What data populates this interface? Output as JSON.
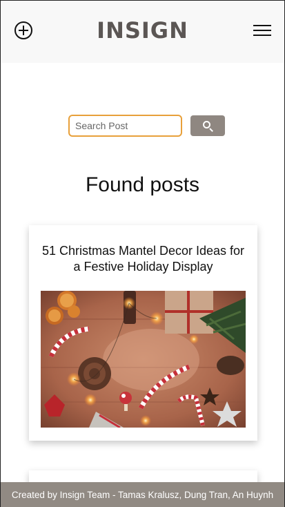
{
  "header": {
    "logo": "INSIGN",
    "add_icon": "plus-circle-icon",
    "menu_icon": "hamburger-menu-icon"
  },
  "search": {
    "placeholder": "Search Post",
    "value": "",
    "button_icon": "search-icon"
  },
  "main": {
    "heading": "Found posts",
    "posts": [
      {
        "title": "51 Christmas Mantel Decor Ideas for a Festive Holiday Display",
        "image": "christmas-decor-photo"
      }
    ]
  },
  "footer": {
    "text": "Created by Insign Team - Tamas Kralusz, Dung Tran, An Huynh"
  },
  "colors": {
    "accent_orange": "#e8a03a",
    "button_taupe": "#8f8781",
    "logo_gray": "#5b5654",
    "footer_bg": "#918a83"
  }
}
